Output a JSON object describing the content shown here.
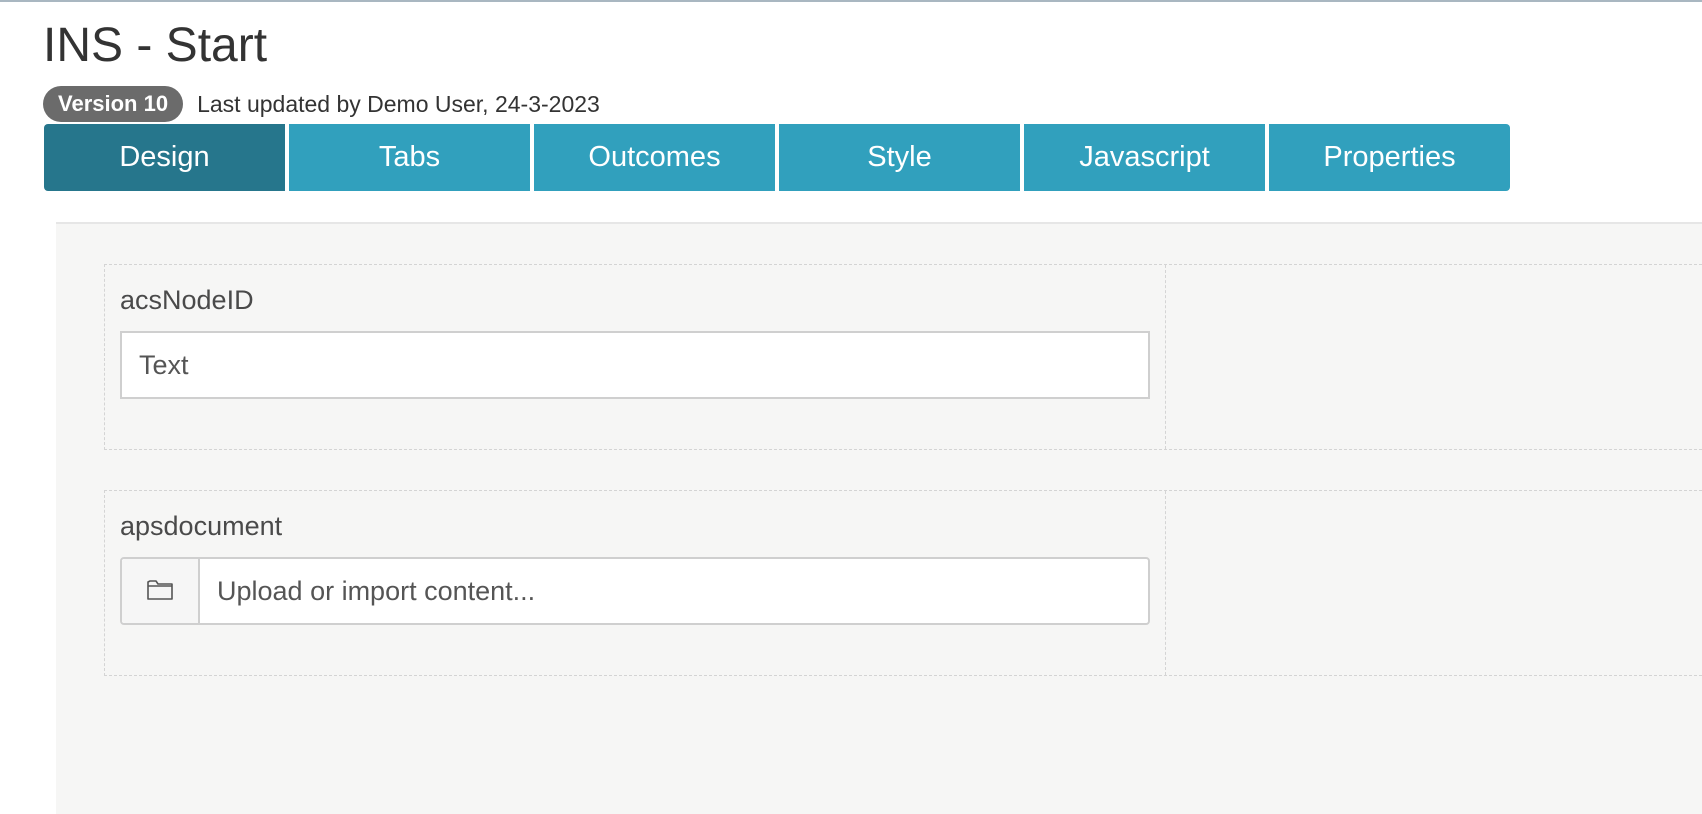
{
  "header": {
    "title": "INS - Start",
    "version_badge": "Version 10",
    "last_updated": "Last updated by Demo User, 24-3-2023"
  },
  "tabs": [
    {
      "label": "Design",
      "active": true
    },
    {
      "label": "Tabs",
      "active": false
    },
    {
      "label": "Outcomes",
      "active": false
    },
    {
      "label": "Style",
      "active": false
    },
    {
      "label": "Javascript",
      "active": false
    },
    {
      "label": "Properties",
      "active": false
    }
  ],
  "form": {
    "fields": [
      {
        "label": "acsNodeID",
        "type": "text",
        "placeholder": "Text"
      },
      {
        "label": "apsdocument",
        "type": "upload",
        "placeholder": "Upload or import content...",
        "icon": "folder-icon"
      }
    ]
  },
  "colors": {
    "tab": "#31a0bd",
    "tab_active": "#26768c",
    "badge": "#6b6b6b",
    "canvas": "#f6f6f5"
  }
}
